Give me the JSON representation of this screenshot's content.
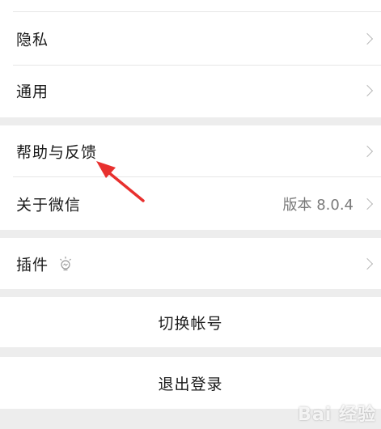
{
  "settings_group_1": {
    "items": [
      {
        "label": "隐私"
      },
      {
        "label": "通用"
      }
    ]
  },
  "settings_group_2": {
    "items": [
      {
        "label": "帮助与反馈"
      },
      {
        "label": "关于微信",
        "value": "版本 8.0.4"
      }
    ]
  },
  "settings_group_3": {
    "items": [
      {
        "label": "插件",
        "icon": "lightbulb-icon"
      }
    ]
  },
  "actions": {
    "switch_account": "切换帐号",
    "logout": "退出登录"
  },
  "annotation": {
    "color": "#e8302e"
  },
  "watermark": {
    "text": "Bai 经验"
  }
}
